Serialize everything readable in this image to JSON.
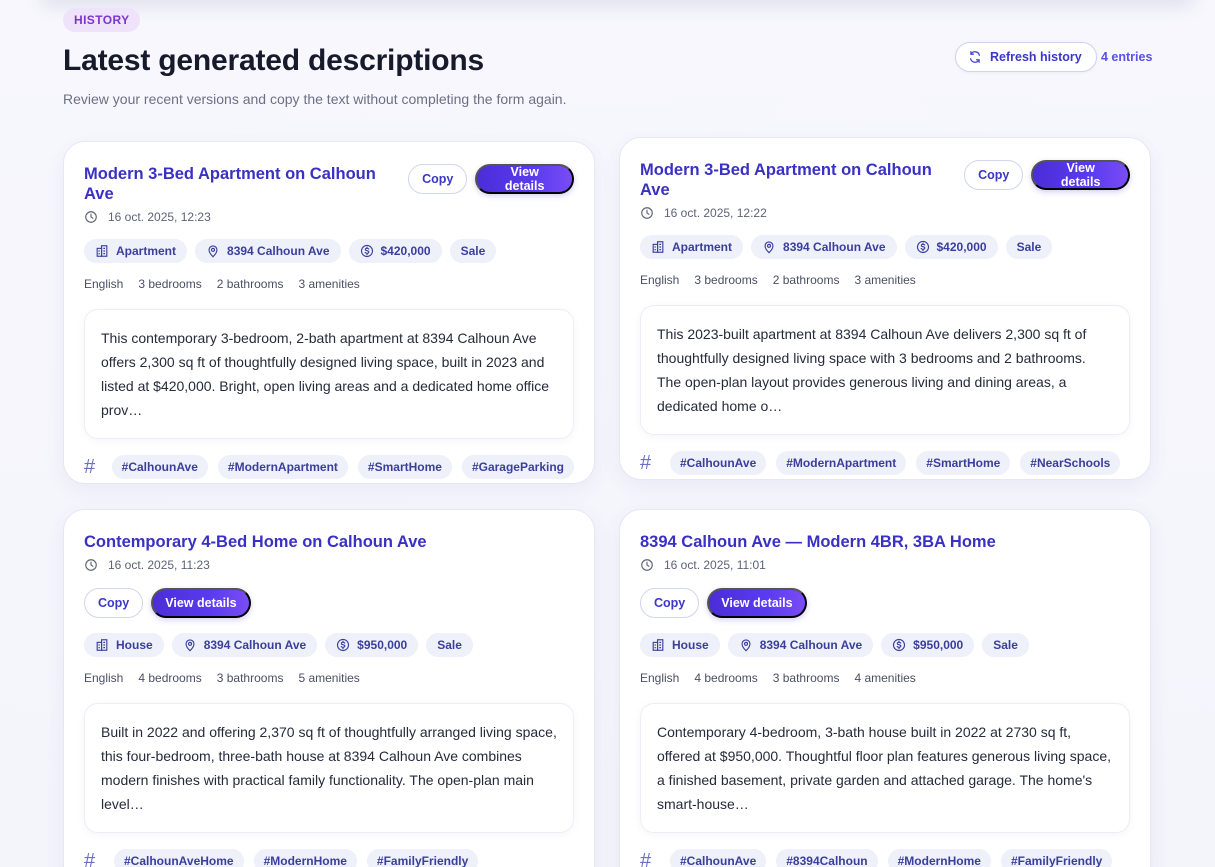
{
  "header": {
    "badge": "HISTORY",
    "title": "Latest generated descriptions",
    "subtitle": "Review your recent versions and copy the text without completing the form again.",
    "refresh_label": "Refresh history",
    "entries": "4 entries"
  },
  "cards": [
    {
      "title": "Modern 3-Bed Apartment on Calhoun Ave",
      "date": "16 oct. 2025, 12:23",
      "copy_label": "Copy",
      "view_label": "View details",
      "type": "Apartment",
      "address": "8394 Calhoun Ave",
      "price": "$420,000",
      "listing": "Sale",
      "language": "English",
      "bedrooms": "3 bedrooms",
      "bathrooms": "2 bathrooms",
      "amenities": "3 amenities",
      "description": "This contemporary 3-bedroom, 2-bath apartment at 8394 Calhoun Ave offers 2,300 sq ft of thoughtfully designed living space, built in 2023 and listed at $420,000. Bright, open living areas and a dedicated home office prov…",
      "tags": [
        "#CalhounAve",
        "#ModernApartment",
        "#SmartHome",
        "#GarageParking"
      ]
    },
    {
      "title": "Modern 3-Bed Apartment on Calhoun Ave",
      "date": "16 oct. 2025, 12:22",
      "copy_label": "Copy",
      "view_label": "View details",
      "type": "Apartment",
      "address": "8394 Calhoun Ave",
      "price": "$420,000",
      "listing": "Sale",
      "language": "English",
      "bedrooms": "3 bedrooms",
      "bathrooms": "2 bathrooms",
      "amenities": "3 amenities",
      "description": "This 2023-built apartment at 8394 Calhoun Ave delivers 2,300 sq ft of thoughtfully designed living space with 3 bedrooms and 2 bathrooms. The open-plan layout provides generous living and dining areas, a dedicated home o…",
      "tags": [
        "#CalhounAve",
        "#ModernApartment",
        "#SmartHome",
        "#NearSchools"
      ]
    },
    {
      "title": "Contemporary 4-Bed Home on Calhoun Ave",
      "date": "16 oct. 2025, 11:23",
      "copy_label": "Copy",
      "view_label": "View details",
      "type": "House",
      "address": "8394 Calhoun Ave",
      "price": "$950,000",
      "listing": "Sale",
      "language": "English",
      "bedrooms": "4 bedrooms",
      "bathrooms": "3 bathrooms",
      "amenities": "5 amenities",
      "description": "Built in 2022 and offering 2,370 sq ft of thoughtfully arranged living space, this four-bedroom, three-bath house at 8394 Calhoun Ave combines modern finishes with practical family functionality. The open-plan main level…",
      "tags": [
        "#CalhounAveHome",
        "#ModernHome",
        "#FamilyFriendly"
      ]
    },
    {
      "title": "8394 Calhoun Ave — Modern 4BR, 3BA Home",
      "date": "16 oct. 2025, 11:01",
      "copy_label": "Copy",
      "view_label": "View details",
      "type": "House",
      "address": "8394 Calhoun Ave",
      "price": "$950,000",
      "listing": "Sale",
      "language": "English",
      "bedrooms": "4 bedrooms",
      "bathrooms": "3 bathrooms",
      "amenities": "4 amenities",
      "description": "Contemporary 4-bedroom, 3-bath house built in 2022 at 2730 sq ft, offered at $950,000. Thoughtful floor plan features generous living space, a finished basement, private garden and attached garage. The home's smart-house…",
      "tags": [
        "#CalhounAve",
        "#8394Calhoun",
        "#ModernHome",
        "#FamilyFriendly"
      ]
    }
  ]
}
